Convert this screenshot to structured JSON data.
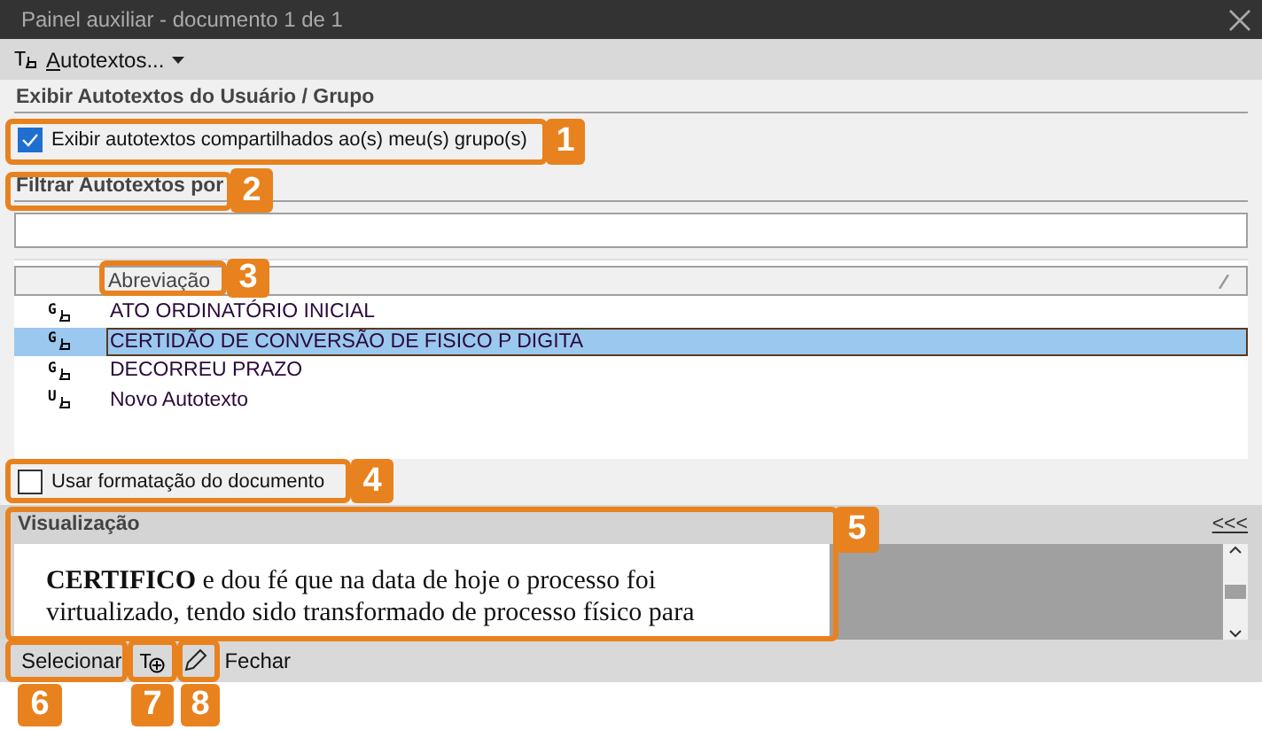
{
  "window": {
    "title": "Painel auxiliar - documento 1 de 1"
  },
  "toolbar": {
    "icon_letter": "T",
    "menu": "Autotextos..."
  },
  "user_group": {
    "title": "Exibir Autotextos do Usuário / Grupo",
    "show_shared": {
      "label": "Exibir autotextos compartilhados ao(s) meu(s) grupo(s)",
      "checked": true
    }
  },
  "filter": {
    "title": "Filtrar Autotextos por"
  },
  "table": {
    "columns": [
      "Abreviação"
    ],
    "rows": [
      {
        "type": "G",
        "name": "ATO ORDINATÓRIO INICIAL",
        "selected": false
      },
      {
        "type": "G",
        "name": "CERTIDÃO DE CONVERSÃO DE FISICO P DIGITA",
        "selected": true
      },
      {
        "type": "G",
        "name": "DECORREU PRAZO",
        "selected": false
      },
      {
        "type": "U",
        "name": "Novo Autotexto",
        "selected": false
      }
    ]
  },
  "use_format": {
    "label": "Usar formatação do documento",
    "checked": false
  },
  "preview": {
    "title": "Visualização",
    "collapse": "<<<",
    "text": "**CERTIFICO** e dou fé que na data de hoje o processo foi virtualizado, tendo sido transformado de processo físico para"
  },
  "footer": {
    "select": "Selecionar",
    "new_icon_letter": "T",
    "close": "Fechar"
  },
  "callouts": [
    {
      "number": "1"
    },
    {
      "number": "2"
    },
    {
      "number": "3"
    },
    {
      "number": "4"
    },
    {
      "number": "5"
    },
    {
      "number": "6"
    },
    {
      "number": "7"
    },
    {
      "number": "8"
    }
  ]
}
